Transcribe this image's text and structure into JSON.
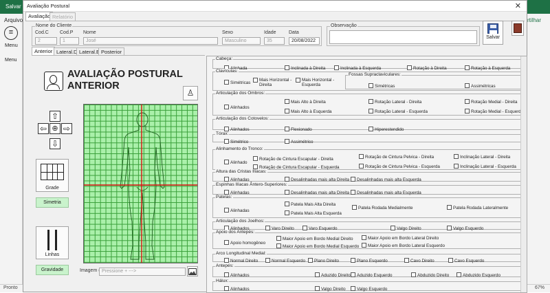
{
  "excel": {
    "save_label": "Salvar",
    "file_label": "Arquivo",
    "menu_label": "Menu",
    "menu_group": "Menu",
    "status": "Pronto",
    "zoom": "67%",
    "right_partial": "rtilhar"
  },
  "dialog": {
    "title": "Avaliação Postural",
    "close": "✕",
    "tabs": [
      "Avaliação",
      "Relatório"
    ],
    "client": {
      "group": "Nome do Cliente",
      "code_c_label": "Cod.C",
      "code_c": "2",
      "code_p_label": "Cod.P",
      "code_p": "1",
      "name_label": "Nome",
      "name": "José",
      "sex_label": "Sexo",
      "sex": "Masculino",
      "age_label": "Idade",
      "age": "35",
      "date_label": "Data",
      "date": "20/08/2022",
      "obs_label": "Observação"
    },
    "save_label": "Salvar",
    "view_tabs": [
      "Anterior",
      "Lateral.D",
      "Lateral.E",
      "Posterior"
    ],
    "heading": [
      "AVALIAÇÃO POSTURAL",
      "ANTERIOR"
    ],
    "grade_label": "Grade",
    "simetria_label": "Simetria",
    "linhas_label": "Linhas",
    "gravidade_label": "Gravidade",
    "image_label": "Imagem (.jpg)",
    "image_placeholder": "Pressione + --->"
  },
  "sections": {
    "cabeca": {
      "title": "Cabeça:",
      "items": [
        "Alinhada",
        "Inclinada à Direita",
        "Inclinada à Esquerda",
        "Rotação à Direita",
        "Rotação à Esquerda"
      ]
    },
    "claviculas": {
      "title": "Clavículas:",
      "items": [
        "Simétricas",
        "Mais Horizontal - Direita",
        "Mais Horizontal - Esquerda"
      ],
      "sub_title": "Fossas Supraclaviculares:",
      "sub_items": [
        "Simétricas",
        "Assimétricas"
      ]
    },
    "ombros": {
      "title": "Articulação dos Ombros:",
      "items": [
        "Alinhados",
        "Mais Alto  à Direita",
        "Mais Alto à Esquerda",
        "Rotação Lateral - Direita",
        "Rotação Lateral -  Esquerda",
        "Rotação Medial - Direita",
        "Rotação Medial -  Esquerda"
      ]
    },
    "cotovelos": {
      "title": "Articulação dos Cotovelos:",
      "items": [
        "Alinhados",
        "Flexionado",
        "Hiperestendido"
      ]
    },
    "torax": {
      "title": "Tórax:",
      "items": [
        "Simétrico",
        "Assimétrico"
      ]
    },
    "tronco": {
      "title": "Alinhamento do Tronco:",
      "items": [
        "Alinhado",
        "Rotação de Cintura Escapular - Direita",
        "Rotação de Cintura Escapular - Esquerda",
        "Rotação de Cintura Pelvica - Direita",
        "Rotação de Cintura Pelvica - Esquerda",
        "Inclinação Lateral - Direita",
        "Inclinação Lateral - Esquerda"
      ]
    },
    "cristas": {
      "title": "Altura das Cristas Ilíacas:",
      "items": [
        "Alinhadas",
        "Desalinhadas mais alta Direita",
        "Desalinhadas mais alta Esquerda"
      ]
    },
    "espinhas": {
      "title": "Espinhas Ilíacas Ântero-Superiores:",
      "items": [
        "Alinhadas",
        "Desalinhadas mais alta Direita",
        "Desalinhadas mais alta Esquerda"
      ]
    },
    "patelas": {
      "title": "Patelas:",
      "items": [
        "Alinhadas",
        "Patela Mais Alta Direita",
        "Patela Mais Alta Esquerda",
        "Patela Rodada Medialmente",
        "Patela Rodada Lateralmente"
      ]
    },
    "joelhos": {
      "title": "Articulação dos Joelhos:",
      "items": [
        "Alinhados",
        "Varo Direito",
        "Varo Esquerdo",
        "Valgo Direito",
        "Valgo Esquerdo"
      ]
    },
    "antepes_apoio": {
      "title": "Apoio dos Antepés:",
      "items": [
        "Apoio homogêneo",
        "Maior Apoio em Bordo Medial Direito",
        "Maior Apoio em Bordo Medial Esquerdo",
        "Maior Apoio em Bordo Lateral Direito",
        "Maior Apoio em Bordo Lateral Esquerdo"
      ]
    },
    "arco": {
      "title": "Arco Longitudinal Medial:",
      "items": [
        "Normal Direito",
        "Normal Esquerdo",
        "Plano Direito",
        "Plano Esquerdo",
        "Cavo Direito",
        "Cavo Esquerdo"
      ]
    },
    "antepes": {
      "title": "Antepés:",
      "items": [
        "Alinhados",
        "Aduzido Direito",
        "Aduzido Esquerdo",
        "Abduzido Direito",
        "Abduzido Esquerdo"
      ]
    },
    "halux": {
      "title": "Hálux:",
      "items": [
        "Alinhados",
        "Valgo Direito",
        "Valgo Esquerdo"
      ]
    }
  }
}
